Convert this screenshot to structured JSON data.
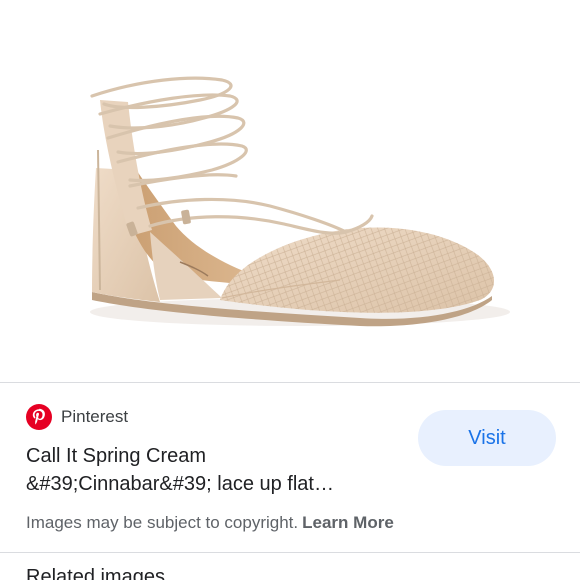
{
  "image": {
    "alt_icon": "shoe-product-image"
  },
  "source": {
    "icon": "pinterest-logo-icon",
    "brand_color": "#e60023",
    "name": "Pinterest"
  },
  "result": {
    "title_line1": "Call It Spring Cream",
    "title_line2": "&#39;Cinnabar&#39; lace up flat…"
  },
  "actions": {
    "visit_label": "Visit",
    "visit_bg": "#e8f0fe",
    "visit_color": "#1a73e8"
  },
  "copyright": {
    "text": "Images may be subject to copyright.",
    "learn_more": "Learn More"
  },
  "related": {
    "heading": "Related images"
  }
}
